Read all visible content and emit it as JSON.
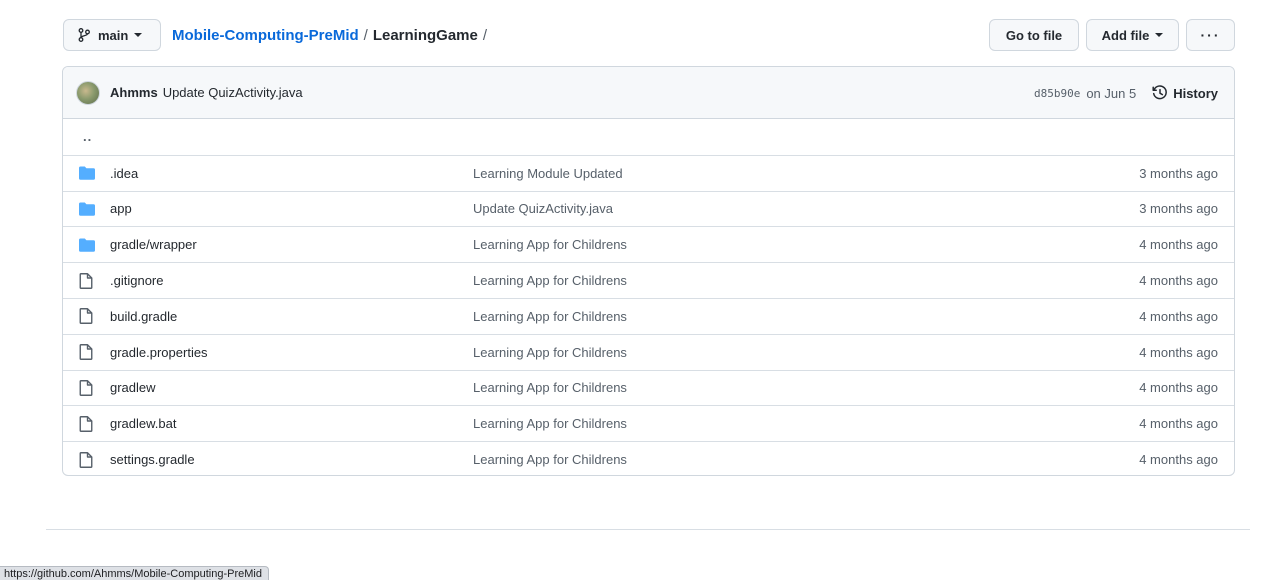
{
  "header": {
    "branch": "main",
    "repo_link": "Mobile-Computing-PreMid",
    "separator": "/",
    "current_dir": "LearningGame",
    "trailing_sep": "/",
    "go_to_file": "Go to file",
    "add_file": "Add file",
    "more": "···"
  },
  "commit": {
    "author": "Ahmms",
    "message": "Update QuizActivity.java",
    "sha": "d85b90e",
    "date": "on Jun 5",
    "history": "History"
  },
  "parent_dir": "..",
  "files": [
    {
      "type": "folder",
      "name": ".idea",
      "message": "Learning Module Updated",
      "age": "3 months ago"
    },
    {
      "type": "folder",
      "name": "app",
      "message": "Update QuizActivity.java",
      "age": "3 months ago"
    },
    {
      "type": "folder",
      "name": "gradle/wrapper",
      "message": "Learning App for Childrens",
      "age": "4 months ago"
    },
    {
      "type": "file",
      "name": ".gitignore",
      "message": "Learning App for Childrens",
      "age": "4 months ago"
    },
    {
      "type": "file",
      "name": "build.gradle",
      "message": "Learning App for Childrens",
      "age": "4 months ago"
    },
    {
      "type": "file",
      "name": "gradle.properties",
      "message": "Learning App for Childrens",
      "age": "4 months ago"
    },
    {
      "type": "file",
      "name": "gradlew",
      "message": "Learning App for Childrens",
      "age": "4 months ago"
    },
    {
      "type": "file",
      "name": "gradlew.bat",
      "message": "Learning App for Childrens",
      "age": "4 months ago"
    },
    {
      "type": "file",
      "name": "settings.gradle",
      "message": "Learning App for Childrens",
      "age": "4 months ago"
    }
  ],
  "status_bar_url": "https://github.com/Ahmms/Mobile-Computing-PreMid",
  "colors": {
    "link": "#0969da",
    "folder_icon": "#54aeff",
    "border": "#d0d7de"
  }
}
